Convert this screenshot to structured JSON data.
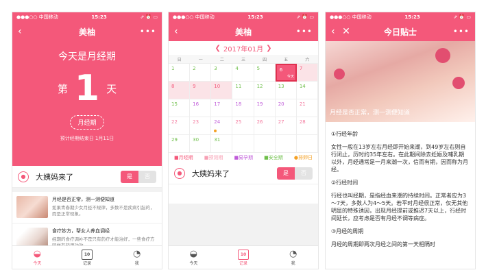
{
  "status": {
    "carrier": "●●●○○ 中国移动",
    "net": "4G",
    "time": "15:23",
    "right": "⇗ ⏰ ▭"
  },
  "phone1": {
    "nav_title": "美柚",
    "hero_title": "今天是月经期",
    "day_prefix": "第",
    "day_number": "1",
    "day_suffix": "天",
    "pill": "月经期",
    "predict": "预计经期结束日 1月11日",
    "question": "大姨妈来了",
    "yes": "是",
    "no": "否",
    "articles": [
      {
        "title": "月经是否正常，测一测便知道",
        "desc": "如果青春期少女月经不规律，多数不是疾病引起的，而是正常现象。"
      },
      {
        "title": "食疗妙方，帮女人养血调经",
        "desc": "经期的食疗调补不是只有药疗才能治好，一些食疗方同样有药用功效。"
      }
    ]
  },
  "tabs": [
    {
      "label": "今天",
      "icon": "bowl-icon"
    },
    {
      "label": "记录",
      "icon": "calendar-icon",
      "num": "10"
    },
    {
      "label": "我",
      "icon": "profile-icon"
    }
  ],
  "phone2": {
    "nav_title": "美柚",
    "month": "2017年01月",
    "weekdays": [
      "日",
      "一",
      "二",
      "三",
      "四",
      "五",
      "六"
    ],
    "days": [
      "1",
      "2",
      "3",
      "4",
      "5",
      "6",
      "7",
      "8",
      "9",
      "10",
      "11",
      "12",
      "13",
      "14",
      "15",
      "16",
      "17",
      "18",
      "19",
      "20",
      "21",
      "22",
      "23",
      "24",
      "25",
      "26",
      "27",
      "28",
      "29",
      "30",
      "31"
    ],
    "today_tag": "今天",
    "legend": [
      "■月经期",
      "■预测期",
      "■易孕期",
      "■安全期",
      "●排卵日"
    ],
    "question": "大姨妈来了",
    "yes": "是",
    "no": "否"
  },
  "phone3": {
    "nav_title": "今日贴士",
    "caption": "月经是否正常，测一测便知道",
    "sections": [
      {
        "heading": "①行经年龄",
        "text": "女性一般在13岁左右月经即开始来潮，到49岁左右则自行闭止，历时约35年左右。在此期间除去妊娠及哺乳期以外，月经通常是一月来潮一次，信而有期，因而称为月经。"
      },
      {
        "heading": "②行经时间",
        "text": "行经也叫经期，是指经血来潮的持续时间。正常者应为3～7天，多数人为4～5天。若平时月经很正常，仅无其他明显的特殊诱因，出现月经提前或推迟7天以上，行经时间延长，应考虑是否有月经不调等病症。"
      },
      {
        "heading": "③月经的周期",
        "text": "月经的周期即两次月经之间的第一天相隔时"
      }
    ]
  },
  "colors": {
    "primary": "#f4587a"
  }
}
